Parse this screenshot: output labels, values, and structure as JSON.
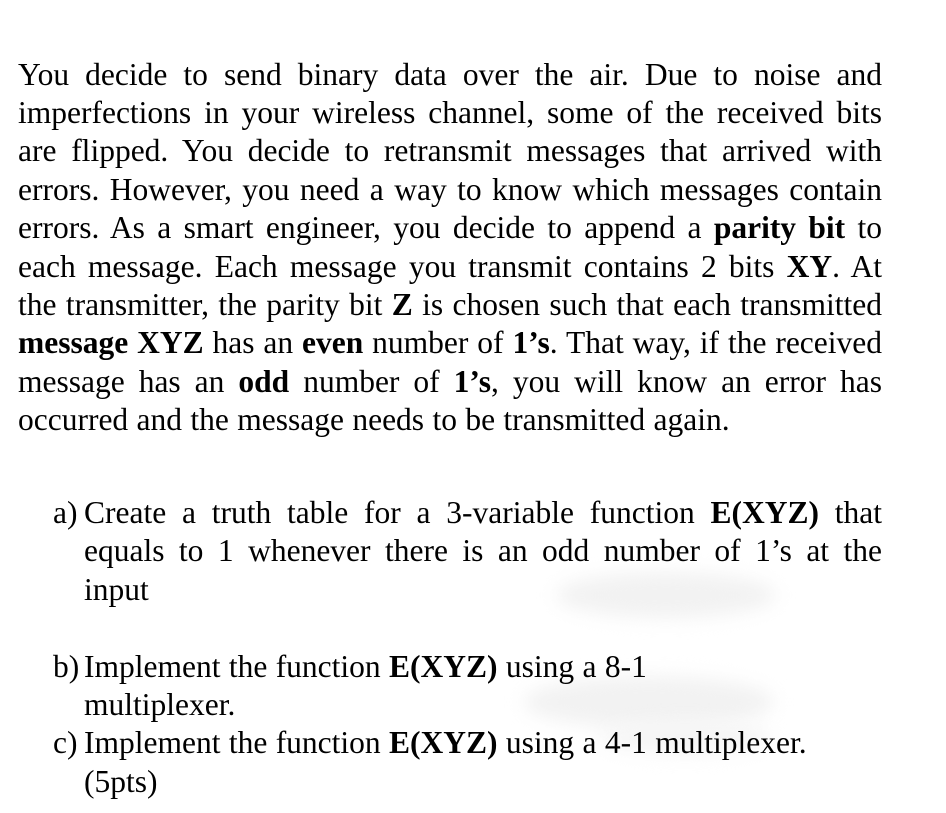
{
  "document": {
    "background_color": "#ffffff",
    "text_color": "#000000",
    "paragraph": {
      "segments": [
        {
          "text": "You decide to send binary data over the air. Due to noise and imperfections in your wireless channel, some of the received bits are flipped. You decide to retransmit messages that arrived with errors. However, you need a way to know which messages contain errors. As a smart engineer, you decide to append a ",
          "bold": false
        },
        {
          "text": "parity bit",
          "bold": true
        },
        {
          "text": " to each message. Each message you transmit contains 2 bits ",
          "bold": false
        },
        {
          "text": "XY",
          "bold": true
        },
        {
          "text": ". At the transmitter, the parity bit ",
          "bold": false
        },
        {
          "text": "Z",
          "bold": true
        },
        {
          "text": " is chosen such that each transmitted ",
          "bold": false
        },
        {
          "text": "message XYZ",
          "bold": true
        },
        {
          "text": " has an ",
          "bold": false
        },
        {
          "text": "even",
          "bold": true
        },
        {
          "text": " number of ",
          "bold": false
        },
        {
          "text": "1’s",
          "bold": true
        },
        {
          "text": ". That way, if the received message has an ",
          "bold": false
        },
        {
          "text": "odd",
          "bold": true
        },
        {
          "text": " number of ",
          "bold": false
        },
        {
          "text": "1’s",
          "bold": true
        },
        {
          "text": ", you will know an error has occurred and the message needs to be transmitted again.",
          "bold": false
        }
      ],
      "plain_text": "You decide to send binary data over the air. Due to noise and imperfections in your wireless channel, some of the received bits are flipped. You decide to retransmit messages that arrived with errors. However, you need a way to know which messages contain errors. As a smart engineer, you decide to append a parity bit to each message. Each message you transmit contains 2 bits XY. At the transmitter, the parity bit Z is chosen such that each transmitted message XYZ has an even number of 1’s. That way, if the received message has an odd number of 1’s, you will know an error has occurred and the message needs to be transmitted again."
    },
    "questions": [
      {
        "marker": "a)",
        "text_before": "Create a truth table for a 3-variable function ",
        "bold_term": "E(XYZ)",
        "text_after": " that equals to 1 whenever there is an odd number of 1’s at the input",
        "plain_text": "a) Create a truth table for a 3-variable function E(XYZ) that equals to 1 whenever there is an odd number of 1’s at the input"
      },
      {
        "marker": "b)",
        "text_before": "Implement the function ",
        "bold_term": "E(XYZ)",
        "text_after": " using a 8-1 multiplexer.",
        "plain_text": "b) Implement the function E(XYZ) using a 8-1 multiplexer."
      },
      {
        "marker": "c)",
        "text_before": "Implement the function ",
        "bold_term": "E(XYZ)",
        "text_after": " using a 4-1 multiplexer. (5pts)",
        "plain_text": "c) Implement the function E(XYZ) using a 4-1 multiplexer. (5pts)"
      }
    ]
  }
}
